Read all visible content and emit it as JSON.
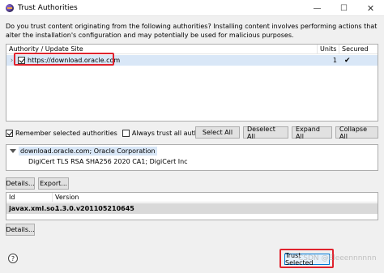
{
  "window": {
    "title": "Trust Authorities",
    "minimize_glyph": "—",
    "maximize_glyph": "☐",
    "close_glyph": "✕",
    "app_icon": "eclipse-icon"
  },
  "intro_text": "Do you trust content originating from the following authorities? Installing content involves performing actions that alter the installation's configuration and may potentially be used for malicious purposes.",
  "authorities_table": {
    "headers": [
      "Authority / Update Site",
      "Units",
      "Secured"
    ],
    "rows": [
      {
        "expander": "›",
        "site": "https://download.oracle.com",
        "checked": true,
        "units": "1",
        "secured": "✔"
      }
    ]
  },
  "options": {
    "remember_label": "Remember selected authorities",
    "remember_checked": true,
    "always_trust_label": "Always trust all authorities",
    "always_trust_checked": false
  },
  "buttons": {
    "select_all": "Select All",
    "deselect_all": "Deselect All",
    "expand_all": "Expand All",
    "collapse_all": "Collapse All",
    "details1": "Details...",
    "export": "Export...",
    "details2": "Details...",
    "trust_selected": "Trust Selected"
  },
  "certificate": {
    "subject": "download.oracle.com; Oracle Corporation",
    "issuer": "DigiCert TLS RSA SHA256 2020 CA1; DigiCert Inc"
  },
  "units_table": {
    "headers": [
      "Id",
      "Version"
    ],
    "rows": [
      {
        "id": "javax.xml.so...",
        "version": "1.3.0.v201105210645"
      }
    ]
  },
  "help_glyph": "?",
  "watermark": "CSDN @Eleeennnnnn",
  "colors": {
    "highlight_red": "#e0232e",
    "selection_blue": "#d9e7f7",
    "default_button_border": "#0078d7"
  }
}
